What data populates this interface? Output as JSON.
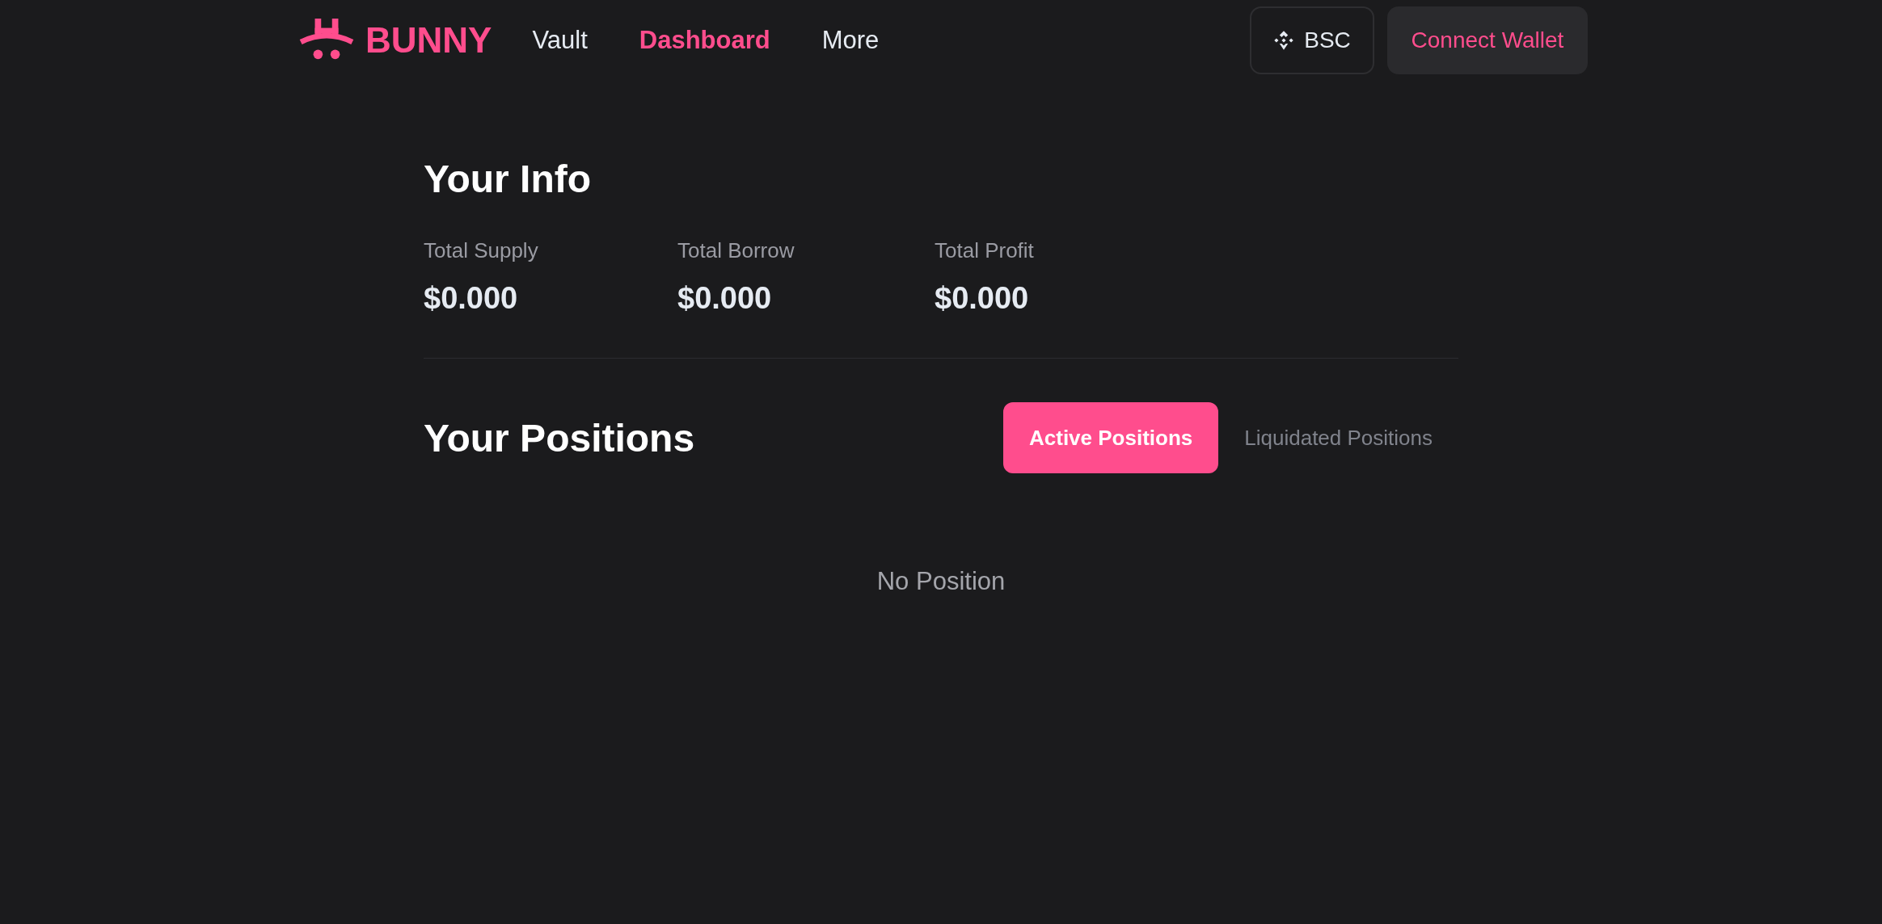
{
  "header": {
    "logo": "BUNNY",
    "nav": [
      {
        "label": "Vault",
        "selected": false
      },
      {
        "label": "Dashboard",
        "selected": true
      },
      {
        "label": "More",
        "selected": false
      }
    ],
    "network": "BSC",
    "connect": "Connect Wallet"
  },
  "info": {
    "title": "Your Info",
    "stats": [
      {
        "label": "Total Supply",
        "value": "$0.000"
      },
      {
        "label": "Total Borrow",
        "value": "$0.000"
      },
      {
        "label": "Total Profit",
        "value": "$0.000"
      }
    ]
  },
  "positions": {
    "title": "Your Positions",
    "tabs": [
      {
        "label": "Active Positions",
        "selected": true
      },
      {
        "label": "Liquidated Positions",
        "selected": false
      }
    ],
    "empty": "No Position"
  }
}
